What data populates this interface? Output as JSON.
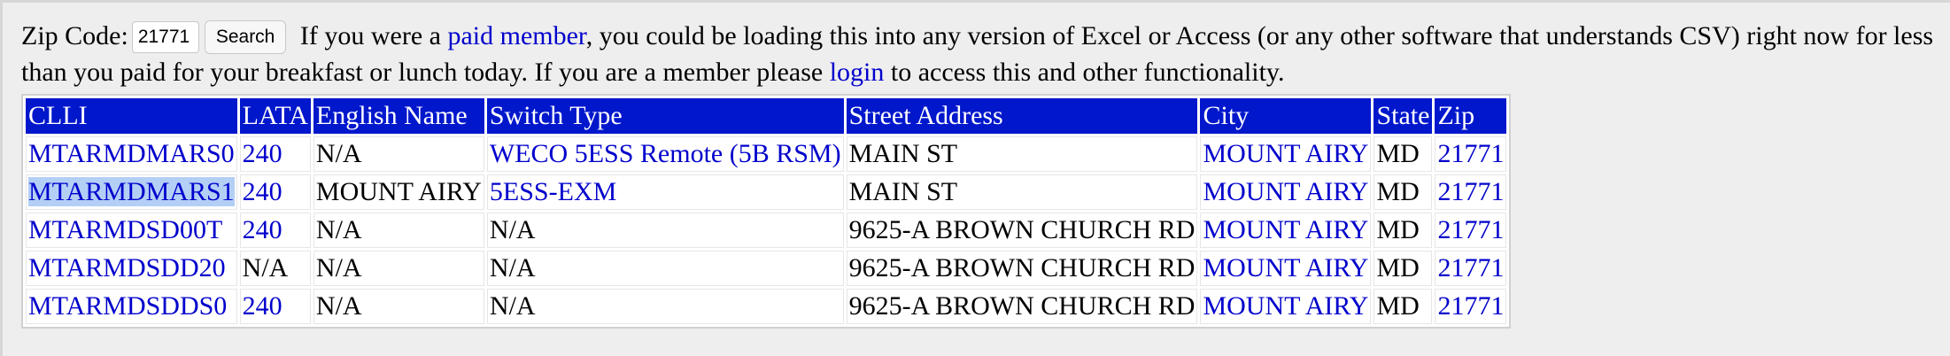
{
  "search": {
    "label": "Zip Code:",
    "value": "21771",
    "button_label": "Search"
  },
  "intro": {
    "text_1": " If you were a ",
    "link_paid_member": "paid member",
    "text_2": ", you could be loading this into any version of Excel or Access (or any other software that understands CSV) right now for less than you paid for your breakfast or lunch today. If you are a member please ",
    "link_login": "login",
    "text_3": " to access this and other functionality."
  },
  "colors": {
    "header_bg": "#0017cc",
    "link": "#0000cc",
    "selection": "#b4cff5"
  },
  "table": {
    "headers": [
      "CLLI",
      "LATA",
      "English Name",
      "Switch Type",
      "Street Address",
      "City",
      "State",
      "Zip"
    ],
    "rows": [
      [
        "MTARMDMARS0",
        "240",
        "N/A",
        "WECO 5ESS Remote (5B RSM)",
        "MAIN ST",
        "MOUNT AIRY",
        "MD",
        "21771"
      ],
      [
        "MTARMDMARS1",
        "240",
        "MOUNT AIRY",
        "5ESS-EXM",
        "MAIN ST",
        "MOUNT AIRY",
        "MD",
        "21771"
      ],
      [
        "MTARMDSD00T",
        "240",
        "N/A",
        "N/A",
        "9625-A BROWN CHURCH RD",
        "MOUNT AIRY",
        "MD",
        "21771"
      ],
      [
        "MTARMDSDD20",
        "N/A",
        "N/A",
        "N/A",
        "9625-A BROWN CHURCH RD",
        "MOUNT AIRY",
        "MD",
        "21771"
      ],
      [
        "MTARMDSDDS0",
        "240",
        "N/A",
        "N/A",
        "9625-A BROWN CHURCH RD",
        "MOUNT AIRY",
        "MD",
        "21771"
      ]
    ]
  }
}
